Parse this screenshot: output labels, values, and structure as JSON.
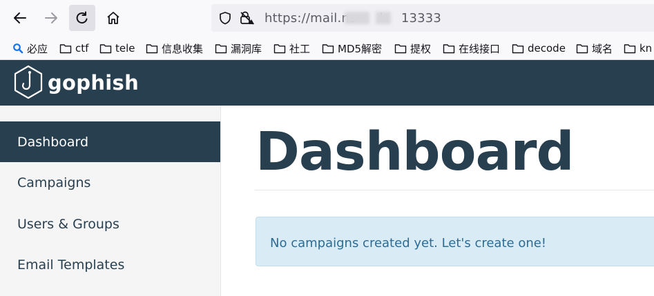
{
  "browser": {
    "url_prefix": "https://mail.",
    "url_part2": "ns",
    "url_part3": "l",
    "url_part4": "13333"
  },
  "bookmarks": [
    {
      "label": "必应",
      "icon": "bing-search-icon"
    },
    {
      "label": "ctf",
      "icon": "folder-icon"
    },
    {
      "label": "tele",
      "icon": "folder-icon"
    },
    {
      "label": "信息收集",
      "icon": "folder-icon"
    },
    {
      "label": "漏洞库",
      "icon": "folder-icon"
    },
    {
      "label": "社工",
      "icon": "folder-icon"
    },
    {
      "label": "MD5解密",
      "icon": "folder-icon"
    },
    {
      "label": "提权",
      "icon": "folder-icon"
    },
    {
      "label": "在线接口",
      "icon": "folder-icon"
    },
    {
      "label": "decode",
      "icon": "folder-icon"
    },
    {
      "label": "域名",
      "icon": "folder-icon"
    },
    {
      "label": "kn",
      "icon": "folder-icon"
    }
  ],
  "app": {
    "brand": "gophish",
    "header_color": "#283f50"
  },
  "sidebar": {
    "items": [
      {
        "label": "Dashboard",
        "active": true
      },
      {
        "label": "Campaigns",
        "active": false
      },
      {
        "label": "Users & Groups",
        "active": false
      },
      {
        "label": "Email Templates",
        "active": false
      }
    ]
  },
  "main": {
    "title": "Dashboard",
    "alert": "No campaigns created yet. Let's create one!"
  }
}
